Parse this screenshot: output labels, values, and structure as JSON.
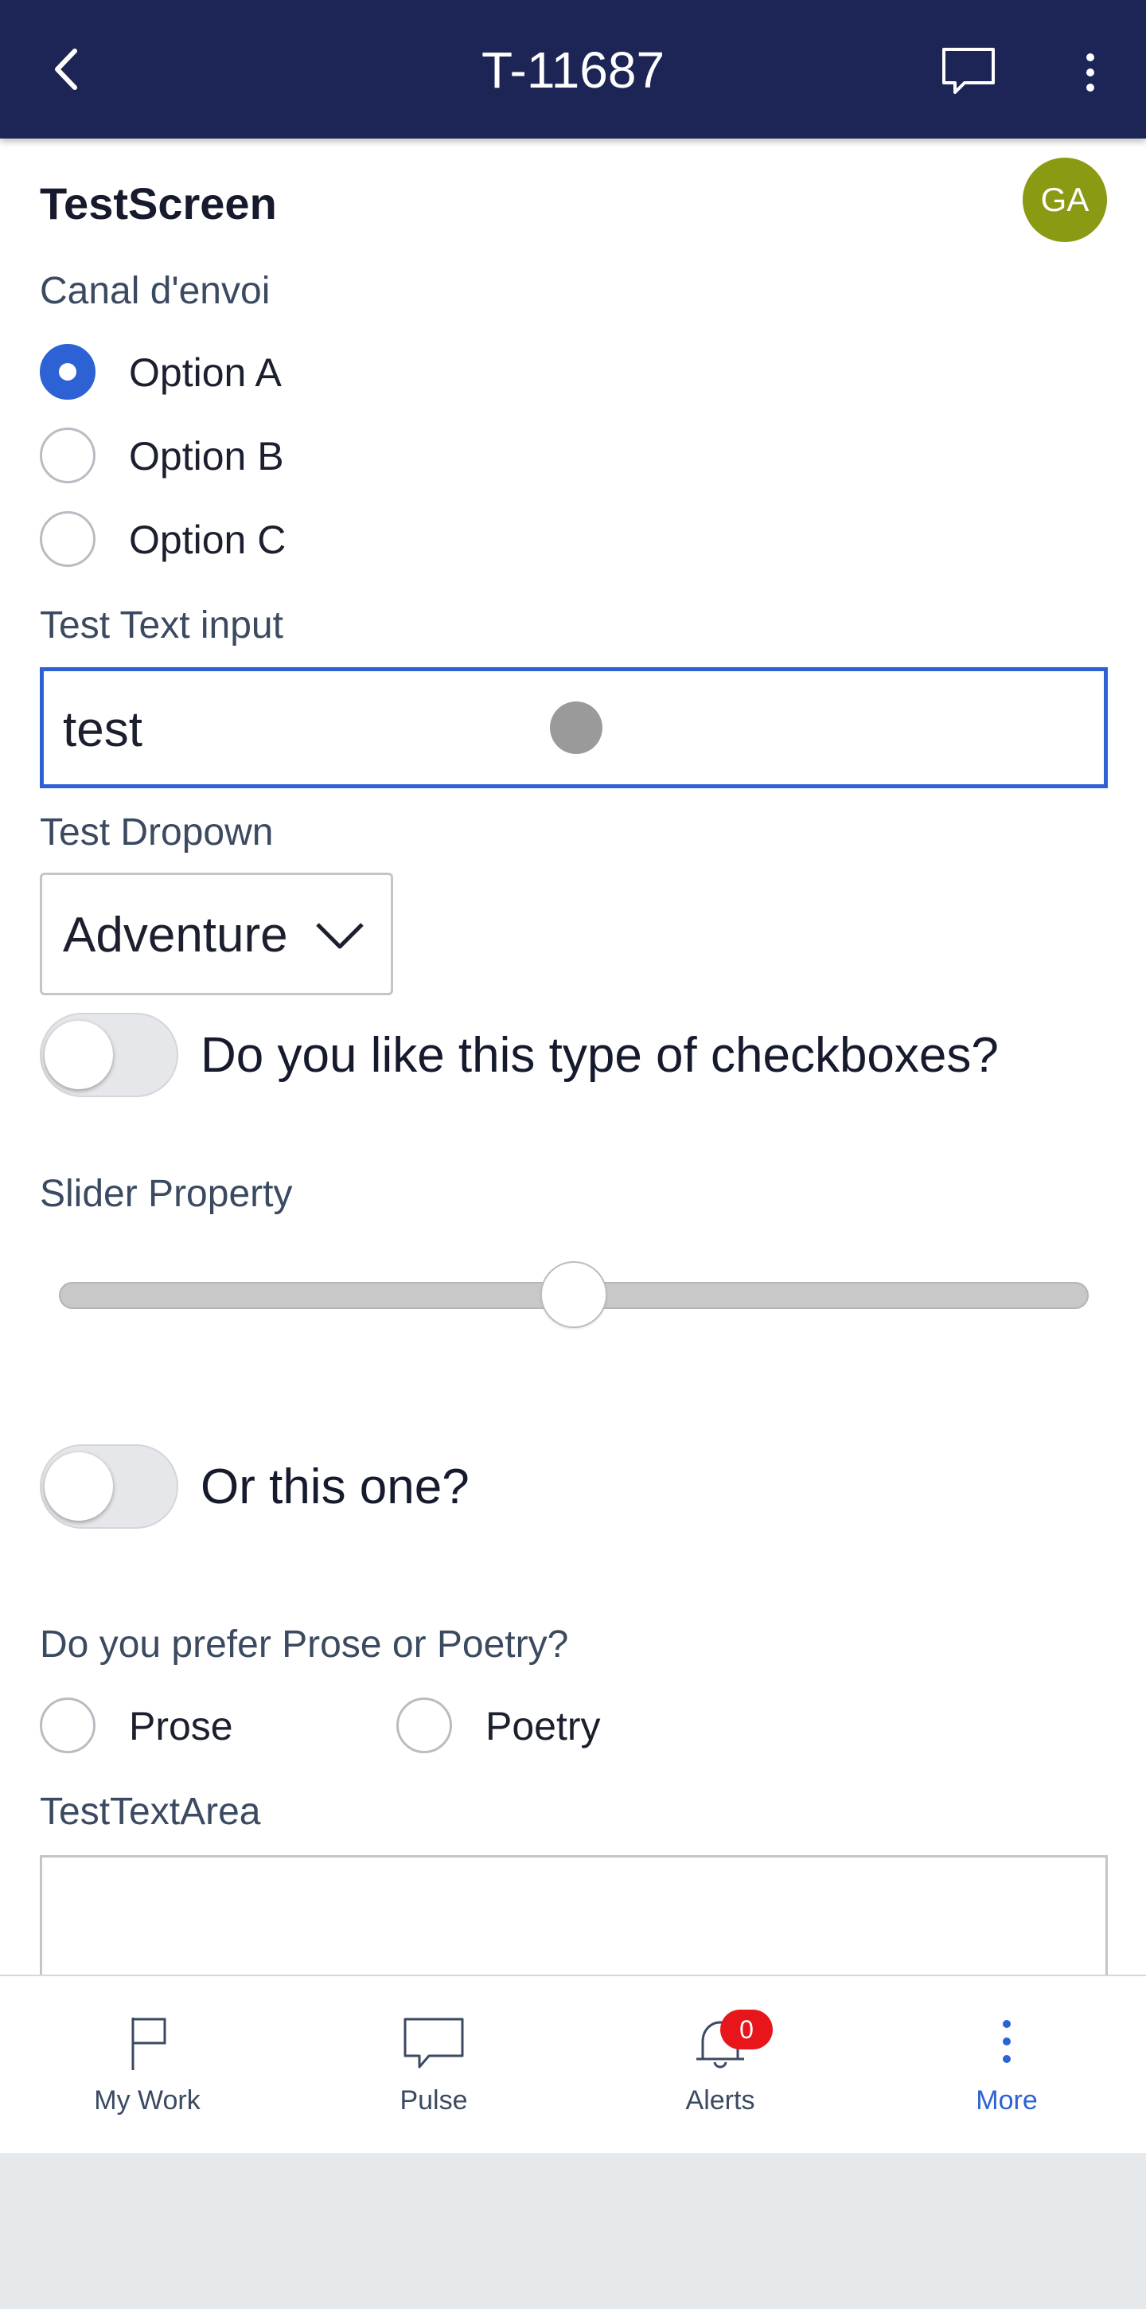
{
  "header": {
    "title": "T-11687"
  },
  "screen": {
    "title": "TestScreen",
    "avatar_initials": "GA",
    "avatar_color": "#8a9a13"
  },
  "canal": {
    "label": "Canal d'envoi",
    "options": [
      "Option A",
      "Option B",
      "Option C"
    ],
    "selected": "Option A"
  },
  "text_input": {
    "label": "Test Text input",
    "value": "test"
  },
  "dropdown": {
    "label": "Test Dropown",
    "value": "Adventure"
  },
  "toggle1": {
    "label": "Do you like this type of checkboxes?",
    "on": false
  },
  "slider": {
    "label": "Slider Property",
    "fraction": 0.5
  },
  "toggle2": {
    "label": "Or this one?",
    "on": false
  },
  "prose_poetry": {
    "label": "Do you prefer Prose or Poetry?",
    "options": [
      "Prose",
      "Poetry"
    ]
  },
  "textarea": {
    "label": "TestTextArea",
    "value": ""
  },
  "nav": {
    "items": [
      {
        "label": "My Work",
        "icon": "flag-icon"
      },
      {
        "label": "Pulse",
        "icon": "chat-bubble-icon"
      },
      {
        "label": "Alerts",
        "icon": "bell-icon",
        "badge": "0"
      },
      {
        "label": "More",
        "icon": "more-vertical-icon"
      }
    ],
    "active": "More"
  },
  "colors": {
    "header_bg": "#1c2556",
    "accent": "#2d62d4",
    "badge": "#e8161b"
  }
}
